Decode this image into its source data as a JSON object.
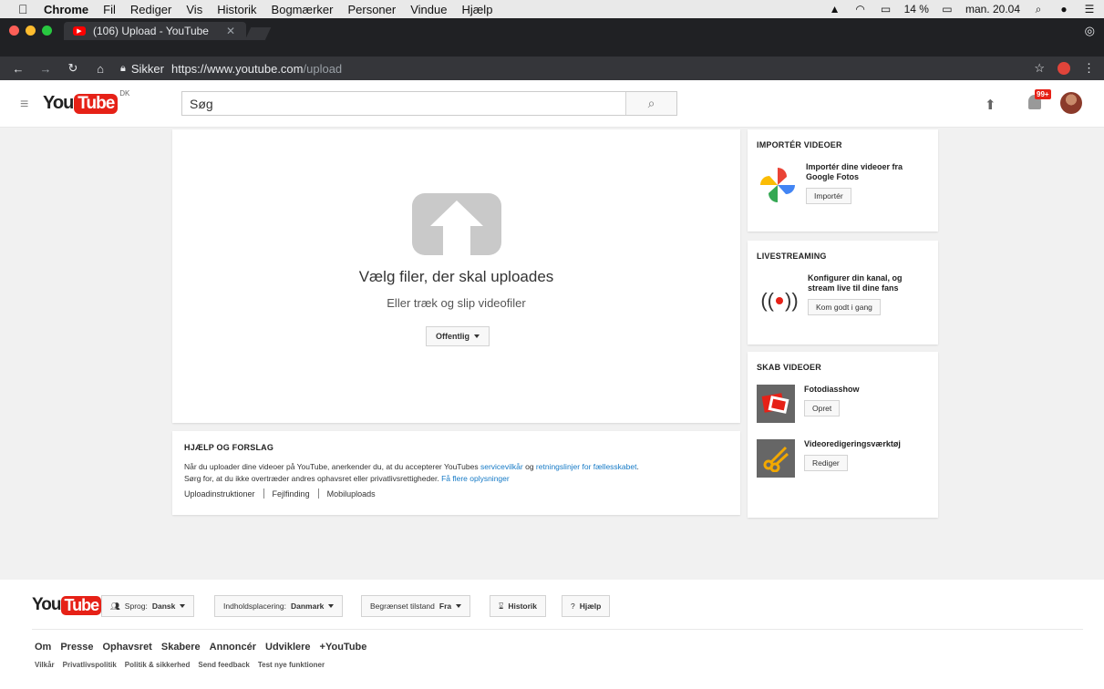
{
  "menubar": {
    "app": "Chrome",
    "items": [
      "Fil",
      "Rediger",
      "Vis",
      "Historik",
      "Bogmærker",
      "Personer",
      "Vindue",
      "Hjælp"
    ],
    "battery": "14 %",
    "clock": "man. 20.04"
  },
  "browser": {
    "tab_title": "(106) Upload - YouTube",
    "secure_label": "Sikker",
    "url_host": "https://www.youtube.com",
    "url_path": "/upload"
  },
  "masthead": {
    "logo_you": "You",
    "logo_tube": "Tube",
    "region": "DK",
    "search_placeholder": "Søg",
    "notification_count": "99+"
  },
  "upload": {
    "title": "Vælg filer, der skal uploades",
    "subtitle": "Eller træk og slip videofiler",
    "privacy": "Offentlig"
  },
  "help": {
    "heading": "HJÆLP OG FORSLAG",
    "text_1": "Når du uploader dine videoer på YouTube, anerkender du, at du accepterer YouTubes ",
    "link_terms": "servicevilkår",
    "text_2": " og ",
    "link_guidelines": "retningslinjer for fællesskabet",
    "text_3": ".",
    "text_4": "Sørg for, at du ikke overtræder andres ophavsret eller privatlivsrettigheder. ",
    "link_more": "Få flere oplysninger",
    "links": [
      "Uploadinstruktioner",
      "Fejlfinding",
      "Mobiluploads"
    ]
  },
  "import": {
    "heading": "IMPORTÉR VIDEOER",
    "text": "Importér dine videoer fra Google Fotos",
    "button": "Importér"
  },
  "live": {
    "heading": "LIVESTREAMING",
    "text": "Konfigurer din kanal, og stream live til dine fans",
    "button": "Kom godt i gang"
  },
  "create": {
    "heading": "SKAB VIDEOER",
    "slideshow": "Fotodiasshow",
    "slideshow_button": "Opret",
    "editor": "Videoredigeringsværktøj",
    "editor_button": "Rediger"
  },
  "footer": {
    "language_label": "Sprog:",
    "language": "Dansk",
    "location_label": "Indholdsplacering:",
    "location": "Danmark",
    "restricted_label": "Begrænset tilstand",
    "restricted": "Fra",
    "history": "Historik",
    "help": "Hjælp",
    "links_primary": [
      "Om",
      "Presse",
      "Ophavsret",
      "Skabere",
      "Annoncér",
      "Udviklere",
      "+YouTube"
    ],
    "links_secondary": [
      "Vilkår",
      "Privatlivspolitik",
      "Politik & sikkerhed",
      "Send feedback",
      "Test nye funktioner"
    ]
  },
  "colors": {
    "brand_red": "#e62117",
    "link_blue": "#167ac6"
  }
}
